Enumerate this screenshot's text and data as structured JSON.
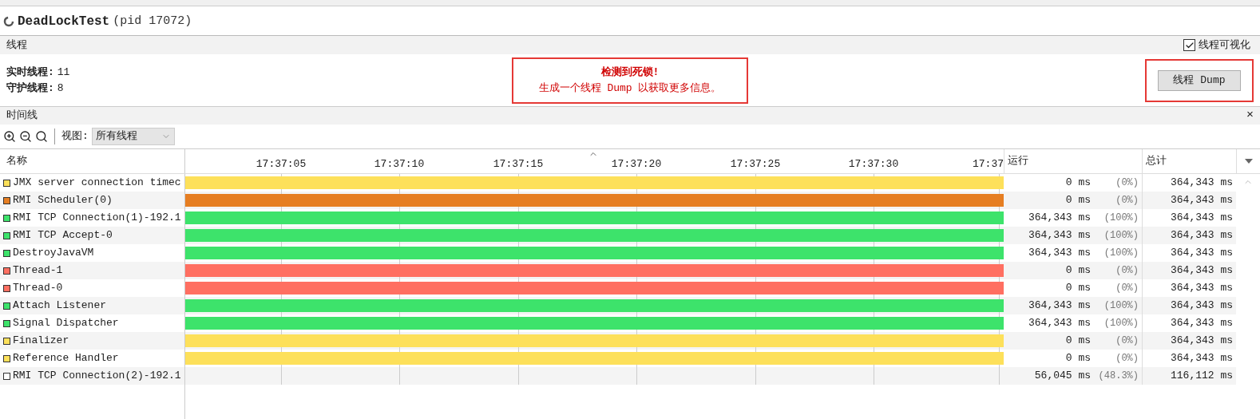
{
  "app": {
    "name": "DeadLockTest",
    "pid": "(pid 17072)"
  },
  "threads_section": {
    "title": "线程",
    "visualize": {
      "label": "线程可视化",
      "checked": true
    },
    "stats": [
      {
        "label": "实时线程:",
        "value": "11"
      },
      {
        "label": "守护线程:",
        "value": "8"
      }
    ],
    "alert": {
      "title": "检测到死锁!",
      "message": "生成一个线程 Dump 以获取更多信息。"
    },
    "dump_button": "线程 Dump"
  },
  "timeline": {
    "title": "时间线",
    "close": "×",
    "view_label": "视图:",
    "view_value": "所有线程",
    "columns": {
      "name": "名称",
      "run": "运行",
      "total": "总计"
    },
    "ticks": [
      "17:37:05",
      "17:37:10",
      "17:37:15",
      "17:37:20",
      "17:37:25",
      "17:37:30",
      "17:37"
    ],
    "rows": [
      {
        "name": "JMX server connection timec",
        "color": "#fde05a",
        "bar": true,
        "run": "0 ms",
        "pct": "(0%)",
        "total": "364,343 ms"
      },
      {
        "name": "RMI Scheduler(0)",
        "color": "#e67e22",
        "bar": true,
        "run": "0 ms",
        "pct": "(0%)",
        "total": "364,343 ms"
      },
      {
        "name": "RMI TCP Connection(1)-192.1",
        "color": "#3de36b",
        "bar": true,
        "run": "364,343 ms",
        "pct": "(100%)",
        "total": "364,343 ms"
      },
      {
        "name": "RMI TCP Accept-0",
        "color": "#3de36b",
        "bar": true,
        "run": "364,343 ms",
        "pct": "(100%)",
        "total": "364,343 ms"
      },
      {
        "name": "DestroyJavaVM",
        "color": "#3de36b",
        "bar": true,
        "run": "364,343 ms",
        "pct": "(100%)",
        "total": "364,343 ms"
      },
      {
        "name": "Thread-1",
        "color": "#ff6f61",
        "bar": true,
        "run": "0 ms",
        "pct": "(0%)",
        "total": "364,343 ms"
      },
      {
        "name": "Thread-0",
        "color": "#ff6f61",
        "bar": true,
        "run": "0 ms",
        "pct": "(0%)",
        "total": "364,343 ms"
      },
      {
        "name": "Attach Listener",
        "color": "#3de36b",
        "bar": true,
        "run": "364,343 ms",
        "pct": "(100%)",
        "total": "364,343 ms"
      },
      {
        "name": "Signal Dispatcher",
        "color": "#3de36b",
        "bar": true,
        "run": "364,343 ms",
        "pct": "(100%)",
        "total": "364,343 ms"
      },
      {
        "name": "Finalizer",
        "color": "#fde05a",
        "bar": true,
        "run": "0 ms",
        "pct": "(0%)",
        "total": "364,343 ms"
      },
      {
        "name": "Reference Handler",
        "color": "#fde05a",
        "bar": true,
        "run": "0 ms",
        "pct": "(0%)",
        "total": "364,343 ms"
      },
      {
        "name": "RMI TCP Connection(2)-192.1",
        "color": "#ffffff",
        "bar": false,
        "run": "56,045 ms",
        "pct": "(48.3%)",
        "total": "116,112 ms"
      }
    ]
  }
}
